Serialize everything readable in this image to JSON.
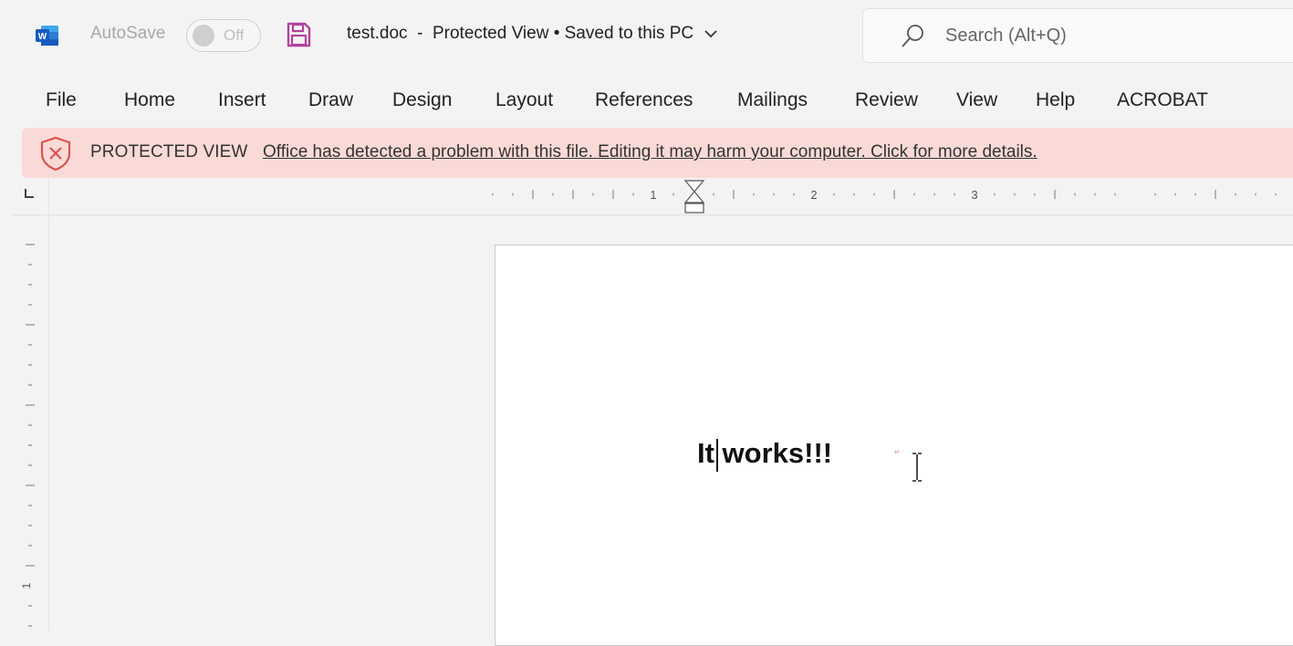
{
  "titlebar": {
    "autosave_label": "AutoSave",
    "autosave_state": "Off",
    "document_title": "test.doc  -  Protected View • Saved to this PC",
    "search_placeholder": "Search (Alt+Q)"
  },
  "menu": {
    "items": [
      "File",
      "Home",
      "Insert",
      "Draw",
      "Design",
      "Layout",
      "References",
      "Mailings",
      "Review",
      "View",
      "Help",
      "ACROBAT"
    ]
  },
  "protected_view": {
    "label": "PROTECTED VIEW",
    "message": "Office has detected a problem with this file. Editing it may harm your computer. Click for more details."
  },
  "ruler": {
    "h_numbers": [
      "1",
      "2",
      "3"
    ],
    "v_numbers": [
      "1"
    ]
  },
  "document": {
    "body_text": "It works!!!"
  },
  "colors": {
    "word_blue": "#185abd",
    "save_icon": "#b0439e",
    "protected_bar_bg": "#fadad6",
    "shield_red": "#d9534f"
  },
  "icons": {
    "app": "word-logo-icon",
    "save": "save-icon",
    "title_dropdown": "chevron-down-icon",
    "search": "search-icon",
    "protected": "shield-x-icon",
    "cursor": "i-beam-cursor-icon"
  }
}
